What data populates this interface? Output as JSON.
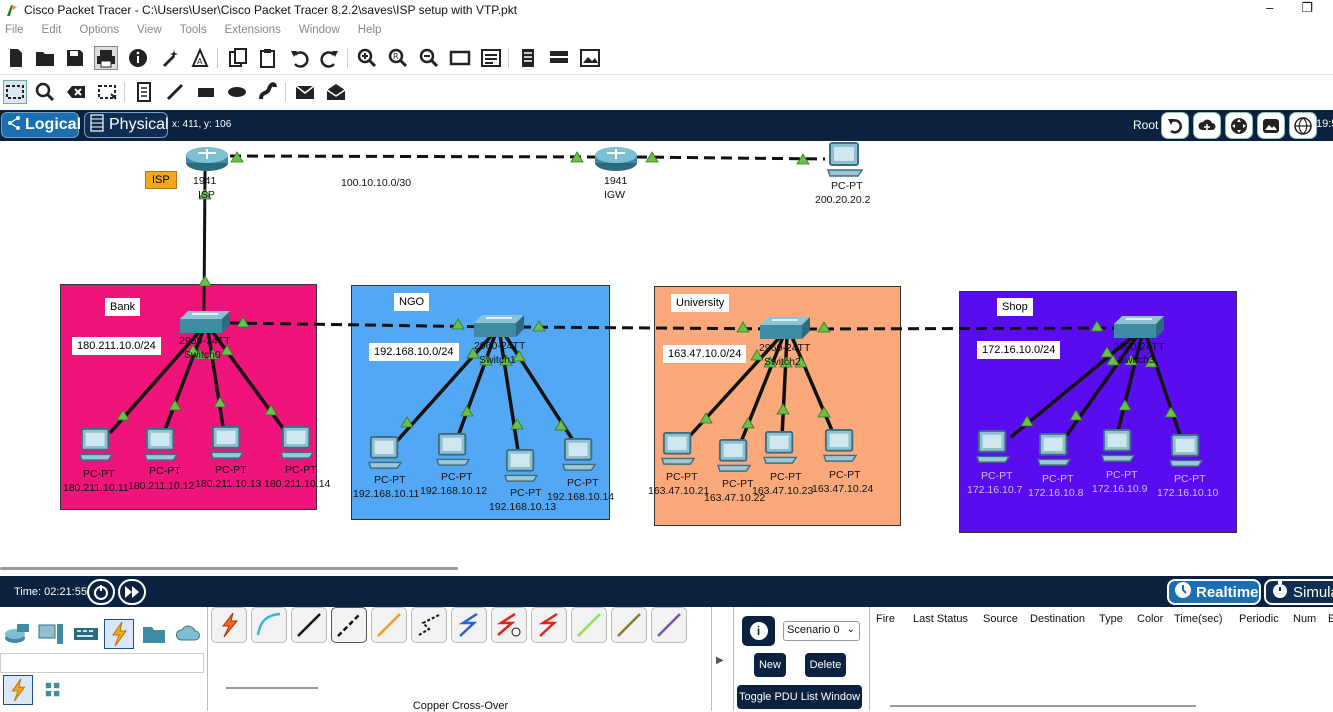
{
  "window": {
    "title": "Cisco Packet Tracer - C:\\Users\\User\\Cisco Packet Tracer 8.2.2\\saves\\ISP setup with VTP.pkt",
    "minimize": "–",
    "restore": "❐"
  },
  "menu": [
    "File",
    "Edit",
    "Options",
    "View",
    "Tools",
    "Extensions",
    "Window",
    "Help"
  ],
  "logical_bar": {
    "logical_label": "Logical",
    "physical_label": "Physical",
    "coordinates": "x: 411, y: 106",
    "root_label": "Root",
    "clock": "19:5"
  },
  "topology": {
    "isp_tag": "ISP",
    "isp_router": {
      "model": "1941",
      "name": "ISP"
    },
    "wan_link": "100.10.10.0/30",
    "igw_router": {
      "model": "1941",
      "name": "IGW"
    },
    "igw_pc": {
      "model": "PC-PT",
      "ip": "200.20.20.2"
    },
    "zones": [
      {
        "name": "Bank",
        "subnet": "180.211.10.0/24",
        "color": "#f0137a",
        "switch_model": "2960-24TT",
        "switch_name": "Switch0",
        "pcs": [
          {
            "model": "PC-PT",
            "ip": "180.211.10.11"
          },
          {
            "model": "PC-PT",
            "ip": "180.211.10.12"
          },
          {
            "model": "PC-PT",
            "ip": "180.211.10.13"
          },
          {
            "model": "PC-PT",
            "ip": "180.211.10.14"
          }
        ]
      },
      {
        "name": "NGO",
        "subnet": "192.168.10.0/24",
        "color": "#53a8f5",
        "switch_model": "2960-24TT",
        "switch_name": "Switch1",
        "pcs": [
          {
            "model": "PC-PT",
            "ip": "192.168.10.11"
          },
          {
            "model": "PC-PT",
            "ip": "192.168.10.12"
          },
          {
            "model": "PC-PT",
            "ip": "192.168.10.13"
          },
          {
            "model": "PC-PT",
            "ip": "192.168.10.14"
          }
        ]
      },
      {
        "name": "University",
        "subnet": "163.47.10.0/24",
        "color": "#fba97a",
        "switch_model": "2960-24TT",
        "switch_name": "Switch2",
        "pcs": [
          {
            "model": "PC-PT",
            "ip": "163.47.10.21"
          },
          {
            "model": "PC-PT",
            "ip": "163.47.10.22"
          },
          {
            "model": "PC-PT",
            "ip": "163.47.10.23"
          },
          {
            "model": "PC-PT",
            "ip": "163.47.10.24"
          }
        ]
      },
      {
        "name": "Shop",
        "subnet": "172.16.10.0/24",
        "color": "#5a0cf0",
        "switch_model": "2960-24TT",
        "switch_name": "Switch3",
        "pcs": [
          {
            "model": "PC-PT",
            "ip": "172.16.10.7"
          },
          {
            "model": "PC-PT",
            "ip": "172.16.10.8"
          },
          {
            "model": "PC-PT",
            "ip": "172.16.10.9"
          },
          {
            "model": "PC-PT",
            "ip": "172.16.10.10"
          }
        ]
      }
    ]
  },
  "bottom_bar": {
    "time": "Time: 02:21:55",
    "realtime": "Realtime",
    "simulation": "Simula"
  },
  "device_panel": {
    "selected_cable": "Copper Cross-Over"
  },
  "pdu_panel": {
    "scenario": "Scenario 0",
    "info": "i",
    "new": "New",
    "delete": "Delete",
    "toggle": "Toggle PDU List Window",
    "columns": [
      "Fire",
      "Last Status",
      "Source",
      "Destination",
      "Type",
      "Color",
      "Time(sec)",
      "Periodic",
      "Num",
      "E"
    ]
  },
  "colors": {
    "link_up": "#6cc04a",
    "dark_navy": "#0a2240",
    "isp_tag": "#f5a623"
  }
}
